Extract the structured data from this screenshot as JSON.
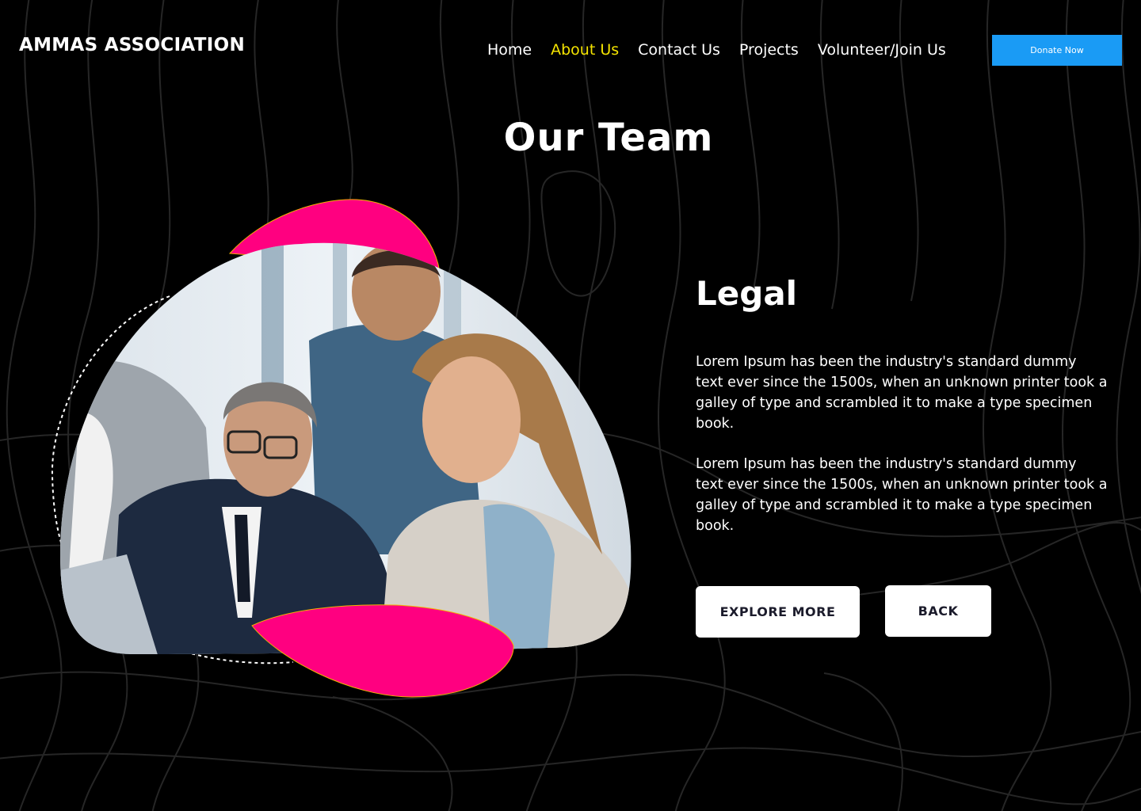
{
  "header": {
    "logo_text": "AMMAS ASSOCIATION",
    "nav": [
      {
        "label": "Home",
        "active": false
      },
      {
        "label": "About Us",
        "active": true
      },
      {
        "label": "Contact Us",
        "active": false
      },
      {
        "label": "Projects",
        "active": false
      },
      {
        "label": "Volunteer/Join Us",
        "active": false
      }
    ],
    "donate_label": "Donate Now"
  },
  "main": {
    "page_title": "Our Team",
    "section_title": "Legal",
    "paragraphs": [
      "Lorem Ipsum has been the industry's standard dummy text ever since the 1500s, when an unknown printer took a galley of type and scrambled it to make a type specimen book.",
      "Lorem Ipsum has been the industry's standard dummy text ever since the 1500s, when an unknown printer took a galley of type and scrambled it to make a type specimen book."
    ],
    "explore_label": "EXPLORE MORE",
    "back_label": "BACK"
  },
  "colors": {
    "background": "#000000",
    "nav_active": "#f5e400",
    "donate_button": "#1a9bf5",
    "accent_blob": "#ff0080",
    "text": "#ffffff"
  },
  "image": {
    "subject": "team-meeting-photo"
  }
}
